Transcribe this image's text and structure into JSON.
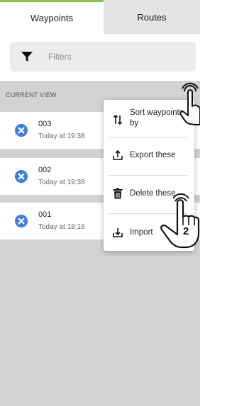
{
  "tabs": [
    {
      "label": "Waypoints",
      "active": true
    },
    {
      "label": "Routes",
      "active": false
    }
  ],
  "filter": {
    "placeholder": "Filters",
    "icon": "filter-icon"
  },
  "section": {
    "label": "CURRENT VIEW"
  },
  "waypoints": [
    {
      "name": "003",
      "time": "Today at 19:38"
    },
    {
      "name": "002",
      "time": "Today at 19:38"
    },
    {
      "name": "001",
      "time": "Today at 18:16"
    }
  ],
  "menu": {
    "items": [
      {
        "label": "Sort waypoints by",
        "icon": "sort-icon"
      },
      {
        "label": "Export these",
        "icon": "export-icon"
      },
      {
        "label": "Delete these",
        "icon": "trash-icon"
      },
      {
        "label": "Import",
        "icon": "import-icon"
      }
    ]
  },
  "annotation": {
    "step_label": "2"
  },
  "colors": {
    "accent": "#8bc34a",
    "delete": "#3f7fe0",
    "list_bg": "#d2d2d2"
  }
}
